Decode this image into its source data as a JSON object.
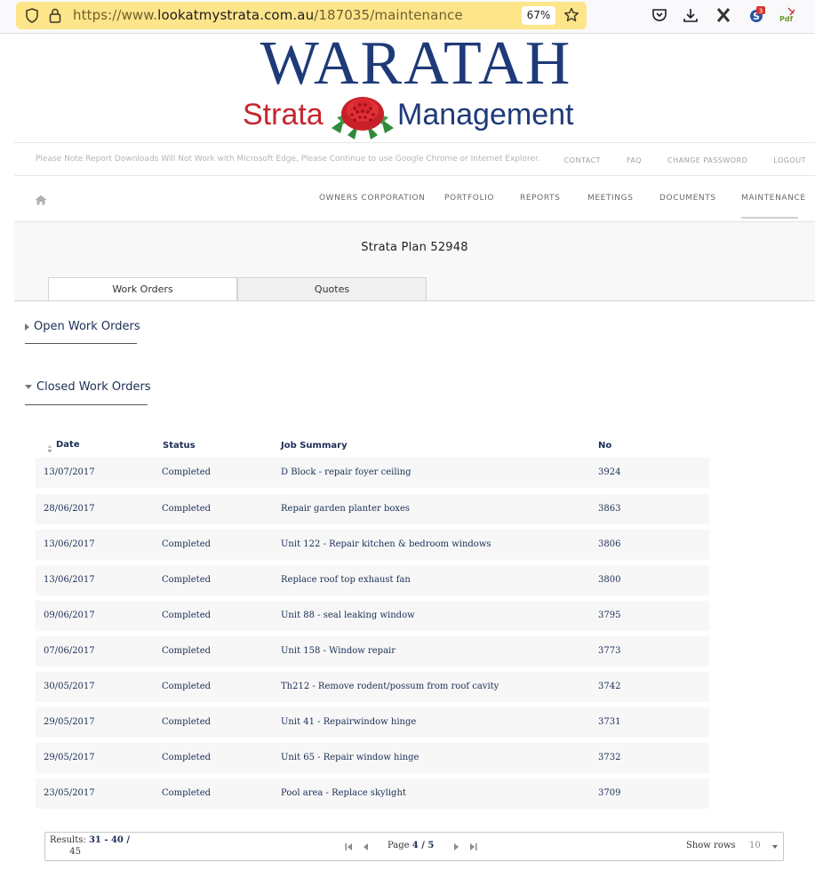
{
  "browser": {
    "url_prefix": "https://www.",
    "url_domain": "lookatmystrata.com.au",
    "url_path": "/187035/maintenance",
    "zoom": "67%",
    "extension_badge": "3"
  },
  "site": {
    "logo_top": "WARATAH",
    "logo_left": "Strata",
    "logo_right": "Management",
    "notice": "Please Note Report Downloads Will Not Work with Microsoft Edge, Please Continue to use Google Chrome or Internet Explorer.",
    "top_links": [
      "CONTACT",
      "FAQ",
      "CHANGE PASSWORD",
      "LOGOUT"
    ],
    "nav": [
      "OWNERS CORPORATION",
      "PORTFOLIO",
      "REPORTS",
      "MEETINGS",
      "DOCUMENTS",
      "MAINTENANCE"
    ],
    "active_nav": "MAINTENANCE"
  },
  "page": {
    "title": "Strata Plan 52948",
    "tabs": [
      "Work Orders",
      "Quotes"
    ],
    "active_tab": "Work Orders",
    "open_section": "Open Work Orders",
    "closed_section": "Closed Work Orders"
  },
  "table": {
    "headers": [
      "Date",
      "Status",
      "Job Summary",
      "No"
    ],
    "rows": [
      [
        "13/07/2017",
        "Completed",
        "D Block - repair foyer ceiling",
        "3924"
      ],
      [
        "28/06/2017",
        "Completed",
        "Repair garden planter boxes",
        "3863"
      ],
      [
        "13/06/2017",
        "Completed",
        "Unit 122 - Repair kitchen & bedroom windows",
        "3806"
      ],
      [
        "13/06/2017",
        "Completed",
        "Replace roof top exhaust fan",
        "3800"
      ],
      [
        "09/06/2017",
        "Completed",
        "Unit 88 - seal leaking window",
        "3795"
      ],
      [
        "07/06/2017",
        "Completed",
        "Unit 158 - Window repair",
        "3773"
      ],
      [
        "30/05/2017",
        "Completed",
        "Th212 - Remove rodent/possum from roof cavity",
        "3742"
      ],
      [
        "29/05/2017",
        "Completed",
        "Unit 41 - Repairwindow hinge",
        "3731"
      ],
      [
        "29/05/2017",
        "Completed",
        "Unit 65 - Repair window hinge",
        "3732"
      ],
      [
        "23/05/2017",
        "Completed",
        "Pool area - Replace skylight",
        "3709"
      ]
    ]
  },
  "pager": {
    "results_label": "Results:",
    "results_range": "31 - 40",
    "results_sep": " /",
    "results_total": "45",
    "page_label": "Page",
    "page_value": "4 / 5",
    "show_rows_label": "Show rows",
    "rows_value": "10"
  }
}
